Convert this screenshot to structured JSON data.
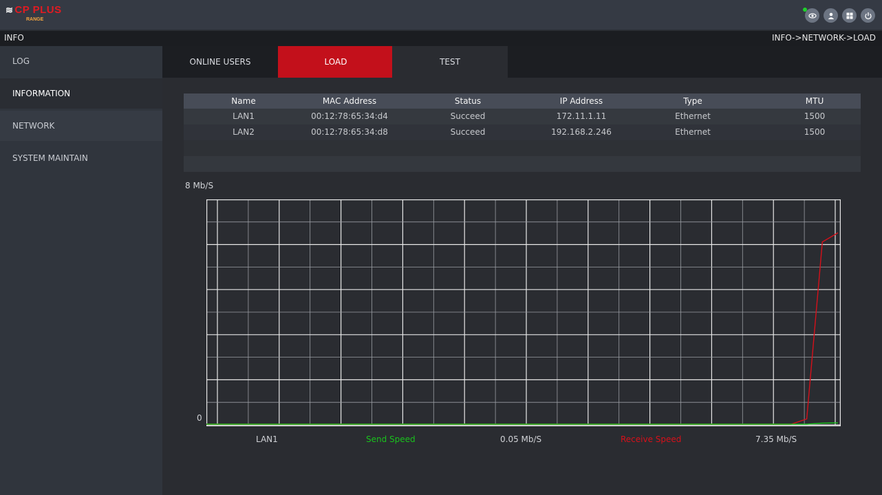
{
  "brand": {
    "logo_text": "CP PLUS",
    "logo_sub": "RANGE"
  },
  "top_icons": [
    {
      "name": "eye-icon",
      "status_dot_color": "#1fd12b"
    },
    {
      "name": "user-icon"
    },
    {
      "name": "grid-icon"
    },
    {
      "name": "power-icon"
    }
  ],
  "infobar": {
    "title": "INFO",
    "breadcrumb": "INFO->NETWORK->LOAD"
  },
  "sidebar": {
    "items": [
      {
        "label": "LOG"
      },
      {
        "label": "INFORMATION"
      },
      {
        "label": "NETWORK"
      },
      {
        "label": "SYSTEM MAINTAIN"
      }
    ]
  },
  "tabs": [
    {
      "label": "ONLINE USERS"
    },
    {
      "label": "LOAD"
    },
    {
      "label": "TEST"
    }
  ],
  "table": {
    "columns": [
      "Name",
      "MAC Address",
      "Status",
      "IP Address",
      "Type",
      "MTU"
    ],
    "rows": [
      [
        "LAN1",
        "00:12:78:65:34:d4",
        "Succeed",
        "172.11.1.11",
        "Ethernet",
        "1500"
      ],
      [
        "LAN2",
        "00:12:78:65:34:d8",
        "Succeed",
        "192.168.2.246",
        "Ethernet",
        "1500"
      ]
    ]
  },
  "chart_data": {
    "type": "line",
    "title": "",
    "y_max_label": "8 Mb/S",
    "y_min_label": "0",
    "ylim": [
      0,
      8
    ],
    "series": [
      {
        "name": "Receive Speed",
        "color": "#d7101a",
        "values": [
          0,
          0,
          0,
          0,
          0,
          0,
          0,
          0,
          0,
          0,
          0,
          0,
          0,
          0,
          0,
          0,
          0,
          0,
          0,
          0,
          0,
          0,
          0,
          0,
          0,
          0,
          0,
          0,
          0,
          0,
          0,
          0,
          0,
          0,
          0,
          0,
          0,
          0,
          0,
          0.2,
          7.0,
          7.35
        ]
      },
      {
        "name": "Send Speed",
        "color": "#19c21c",
        "values": [
          0,
          0,
          0,
          0,
          0,
          0,
          0,
          0,
          0,
          0,
          0,
          0,
          0,
          0,
          0,
          0,
          0,
          0,
          0,
          0,
          0,
          0,
          0,
          0,
          0,
          0,
          0,
          0,
          0,
          0,
          0,
          0,
          0,
          0,
          0,
          0,
          0,
          0,
          0,
          0,
          0.04,
          0.05
        ]
      }
    ],
    "legend": {
      "interface": "LAN1",
      "send_label": "Send Speed",
      "send_value": "0.05 Mb/S",
      "receive_label": "Receive Speed",
      "receive_value": "7.35 Mb/S"
    },
    "grid": true
  },
  "colors": {
    "accent_red": "#c3101b",
    "send_green": "#19c21c",
    "receive_red": "#d7101a"
  }
}
